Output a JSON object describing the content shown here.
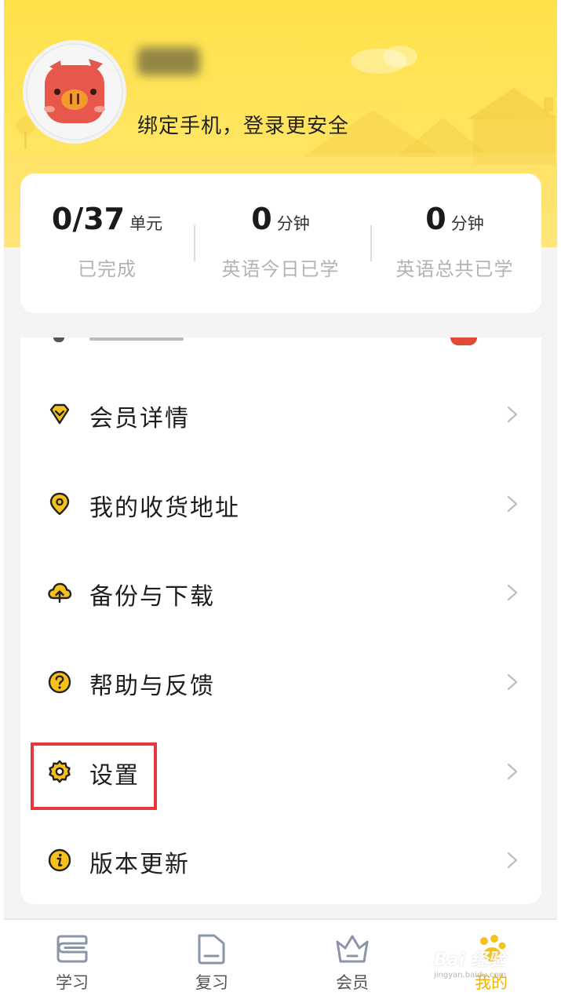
{
  "profile": {
    "bind_tip": "绑定手机，登录更安全"
  },
  "stats": [
    {
      "value": "0/37",
      "unit": "单元",
      "label": "已完成"
    },
    {
      "value": "0",
      "unit": "分钟",
      "label": "英语今日已学"
    },
    {
      "value": "0",
      "unit": "分钟",
      "label": "英语总共已学"
    }
  ],
  "menu": [
    {
      "label": "会员详情",
      "icon": "diamond-icon"
    },
    {
      "label": "我的收货地址",
      "icon": "location-pin-icon"
    },
    {
      "label": "备份与下载",
      "icon": "cloud-upload-icon"
    },
    {
      "label": "帮助与反馈",
      "icon": "question-icon"
    },
    {
      "label": "设置",
      "icon": "gear-icon"
    },
    {
      "label": "版本更新",
      "icon": "info-icon"
    }
  ],
  "tabs": [
    {
      "label": "学习",
      "icon": "book-icon",
      "active": false
    },
    {
      "label": "复习",
      "icon": "folder-icon",
      "active": false
    },
    {
      "label": "会员",
      "icon": "crown-icon",
      "active": false
    },
    {
      "label": "我的",
      "icon": "paw-icon",
      "active": true
    }
  ],
  "watermark": {
    "text": "Bai 经验",
    "sub": "jingyan.baidu.com"
  },
  "colors": {
    "accent": "#f5c21b",
    "highlight": "#e5383b",
    "header": "#ffe24a"
  }
}
